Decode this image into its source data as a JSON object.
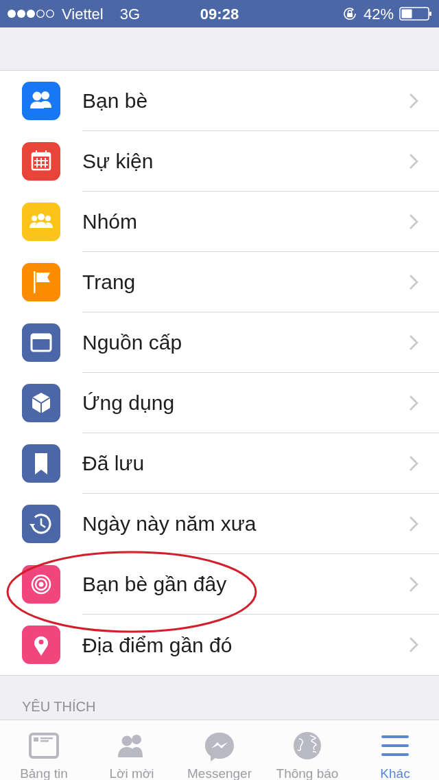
{
  "status_bar": {
    "carrier": "Viettel",
    "network": "3G",
    "time": "09:28",
    "battery": "42%"
  },
  "menu_items": [
    {
      "label": "Bạn bè",
      "color": "#1877f2",
      "circled": false
    },
    {
      "label": "Sự kiện",
      "color": "#e8443a",
      "circled": false
    },
    {
      "label": "Nhóm",
      "color": "#fcc419",
      "circled": false
    },
    {
      "label": "Trang",
      "color": "#fb8c00",
      "circled": false
    },
    {
      "label": "Nguồn cấp",
      "color": "#4c67a8",
      "circled": false
    },
    {
      "label": "Ứng dụng",
      "color": "#4c67a8",
      "circled": false
    },
    {
      "label": "Đã lưu",
      "color": "#4c67a8",
      "circled": false
    },
    {
      "label": "Ngày này năm xưa",
      "color": "#4c67a8",
      "circled": false
    },
    {
      "label": "Bạn bè gần đây",
      "color": "#f0457d",
      "circled": true
    },
    {
      "label": "Địa điểm gần đó",
      "color": "#f0457d",
      "circled": false
    }
  ],
  "section_header": "YÊU THÍCH",
  "tabs": [
    {
      "label": "Bảng tin",
      "selected": false
    },
    {
      "label": "Lời mời",
      "selected": false
    },
    {
      "label": "Messenger",
      "selected": false
    },
    {
      "label": "Thông báo",
      "selected": false
    },
    {
      "label": "Khác",
      "selected": true
    }
  ]
}
